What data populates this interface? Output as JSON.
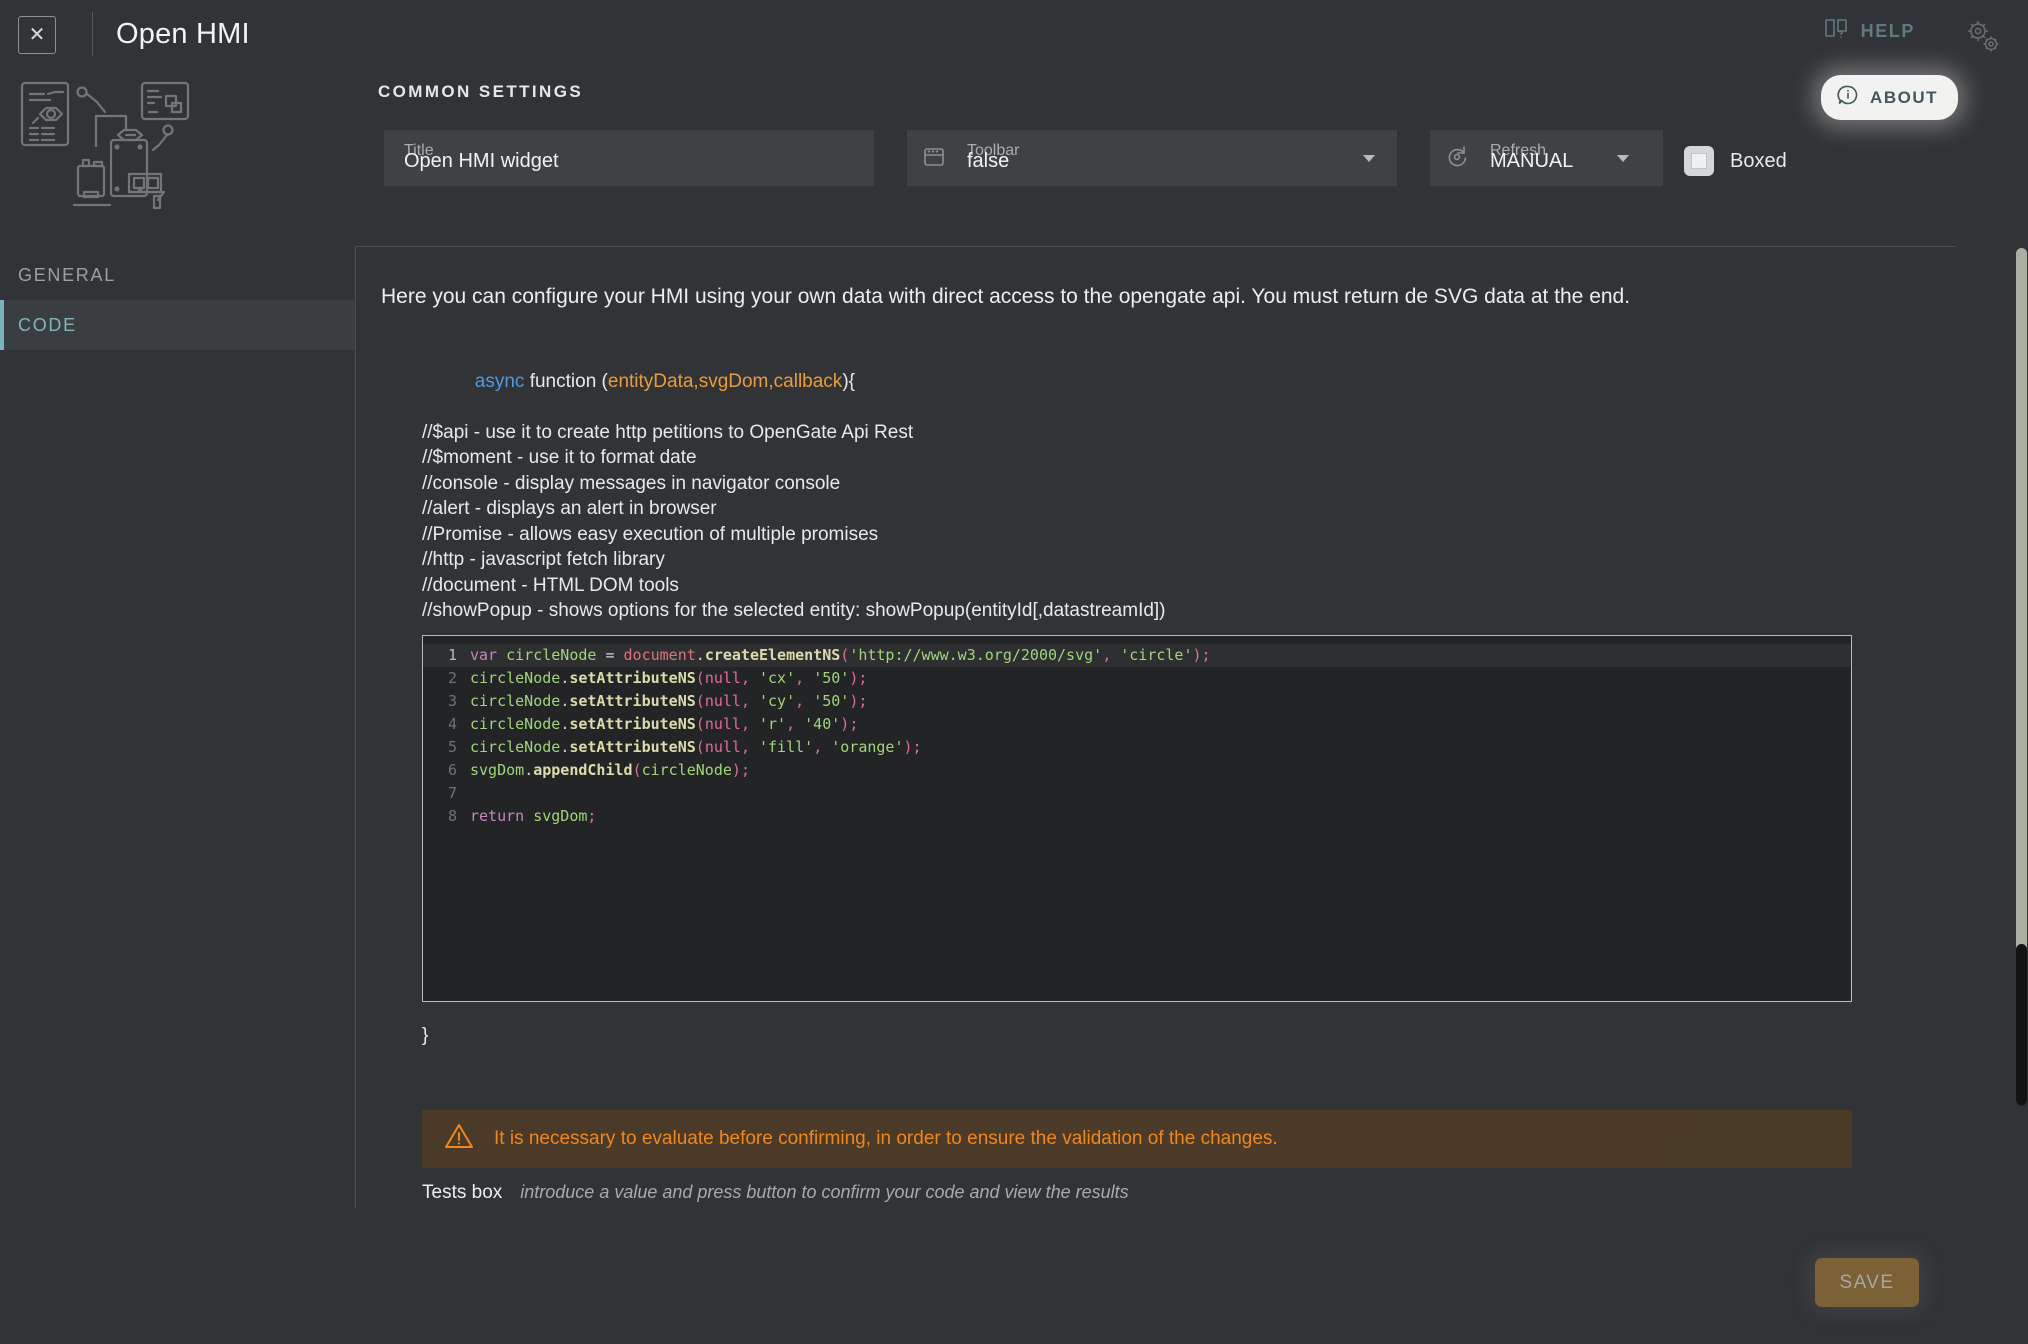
{
  "window": {
    "title": "Open HMI",
    "close_label": "✕"
  },
  "topbar": {
    "help_label": "HELP",
    "about_label": "ABOUT"
  },
  "settings": {
    "section_label": "COMMON SETTINGS",
    "title_field": {
      "label": "Title",
      "value": "Open HMI widget"
    },
    "toolbar_field": {
      "label": "Toolbar",
      "value": "false"
    },
    "refresh_field": {
      "label": "Refresh",
      "value": "MANUAL"
    },
    "boxed": {
      "label": "Boxed",
      "checked": true
    }
  },
  "sidebar": {
    "items": [
      {
        "label": "GENERAL",
        "active": false
      },
      {
        "label": "CODE",
        "active": true
      }
    ]
  },
  "main": {
    "intro": "Here you can configure your HMI using your own data with direct access to the opengate api. You must return de SVG data at the end.",
    "signature": {
      "async": "async",
      "function": " function (",
      "args": "entityData,svgDom,callback",
      "tail": "){"
    },
    "comments": [
      "//$api - use it to create http petitions to OpenGate Api Rest",
      "//$moment - use it to format date",
      "//console - display messages in navigator console",
      "//alert - displays an alert in browser",
      "//Promise - allows easy execution of multiple promises",
      "//http - javascript fetch library",
      "//document - HTML DOM tools",
      "//showPopup - shows options for the selected entity: showPopup(entityId[,datastreamId])"
    ],
    "closing_brace": "}",
    "warning_text": "It is necessary to evaluate before confirming, in order to ensure the validation of the changes.",
    "tests_label": "Tests box",
    "tests_placeholder": "introduce a value and press button to confirm your code and view the results"
  },
  "editor": {
    "lines": [
      {
        "n": "1",
        "active": true,
        "text": "var circleNode = document.createElementNS('http://www.w3.org/2000/svg', 'circle');"
      },
      {
        "n": "2",
        "active": false,
        "text": "circleNode.setAttributeNS(null, 'cx', '50');"
      },
      {
        "n": "3",
        "active": false,
        "text": "circleNode.setAttributeNS(null, 'cy', '50');"
      },
      {
        "n": "4",
        "active": false,
        "text": "circleNode.setAttributeNS(null, 'r', '40');"
      },
      {
        "n": "5",
        "active": false,
        "text": "circleNode.setAttributeNS(null, 'fill', 'orange');"
      },
      {
        "n": "6",
        "active": false,
        "text": "svgDom.appendChild(circleNode);"
      },
      {
        "n": "7",
        "active": false,
        "text": ""
      },
      {
        "n": "8",
        "active": false,
        "text": "return svgDom;"
      }
    ]
  },
  "footer": {
    "save_label": "SAVE"
  },
  "colors": {
    "accent": "#79b4bc",
    "warning": "#f0861e",
    "save_bg": "#7b6134",
    "panel_bg": "#313336",
    "editor_bg": "#232426"
  }
}
